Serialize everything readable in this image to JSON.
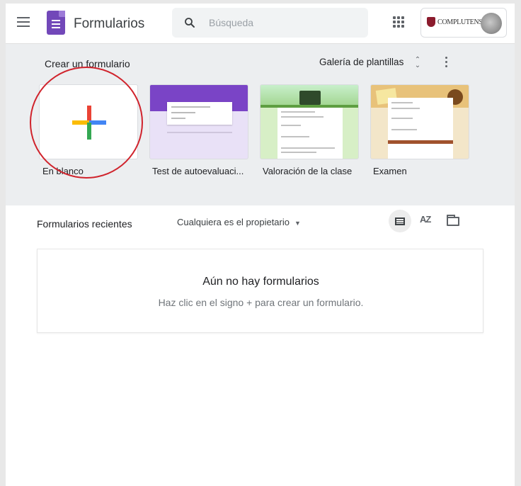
{
  "app": {
    "title": "Formularios"
  },
  "search": {
    "placeholder": "Búsqueda"
  },
  "account": {
    "org_logo_text": "COMPLUTENSE"
  },
  "templates": {
    "create_label": "Crear un formulario",
    "gallery_label": "Galería de plantillas",
    "cards": [
      {
        "label": "En blanco"
      },
      {
        "label": "Test de autoevaluaci..."
      },
      {
        "label": "Valoración de la clase"
      },
      {
        "label": "Examen"
      }
    ]
  },
  "recent": {
    "title": "Formularios recientes",
    "owner_filter": "Cualquiera es el propietario",
    "sort_label": "AZ",
    "empty_title": "Aún no hay formularios",
    "empty_subtitle": "Haz clic en el signo + para crear un formulario."
  },
  "colors": {
    "forms_purple": "#7248b9",
    "highlight_red": "#d0232c",
    "template_bg": "#eceef0"
  }
}
